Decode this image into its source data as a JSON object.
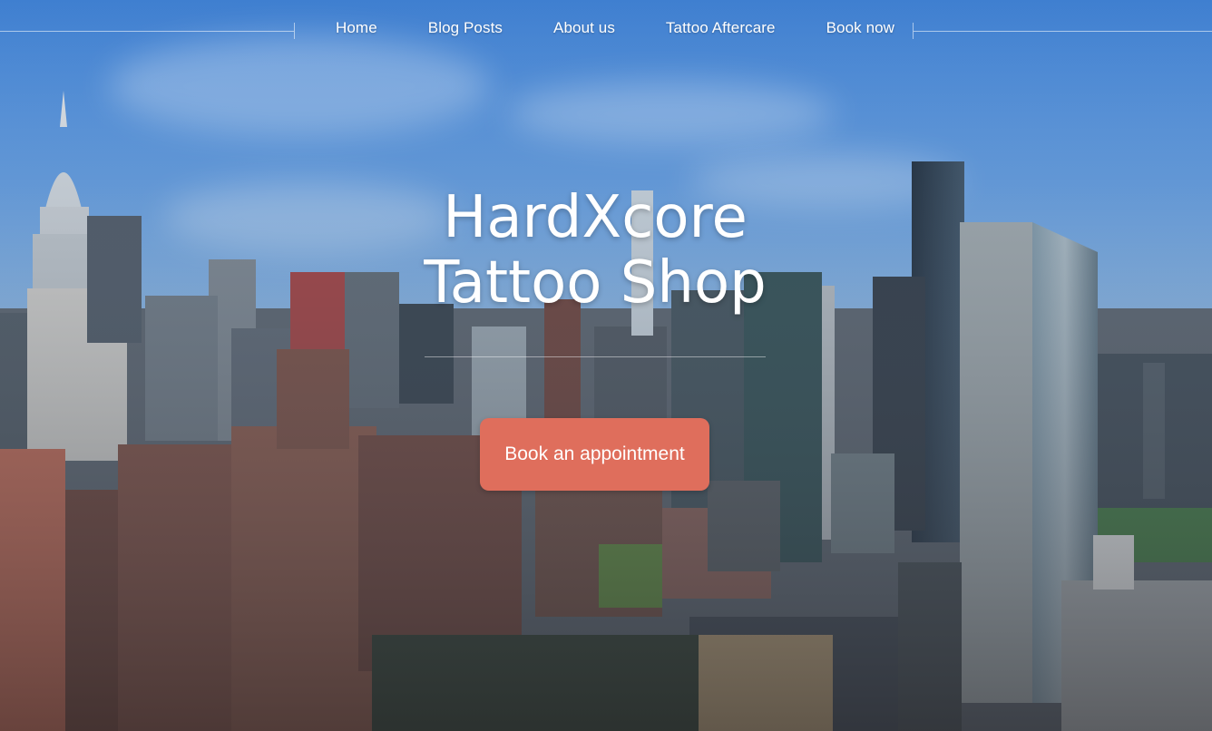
{
  "nav": {
    "items": [
      {
        "label": "Home"
      },
      {
        "label": "Blog Posts"
      },
      {
        "label": "About us"
      },
      {
        "label": "Tattoo Aftercare"
      },
      {
        "label": "Book now"
      }
    ]
  },
  "hero": {
    "title_line1": "HardXcore",
    "title_line2": "Tattoo Shop",
    "cta_label": "Book an appointment",
    "background_image": "aerial city skyline of Manhattan"
  },
  "colors": {
    "cta": "#df6e5c",
    "text": "#ffffff",
    "sky": "#5f9ae0"
  }
}
